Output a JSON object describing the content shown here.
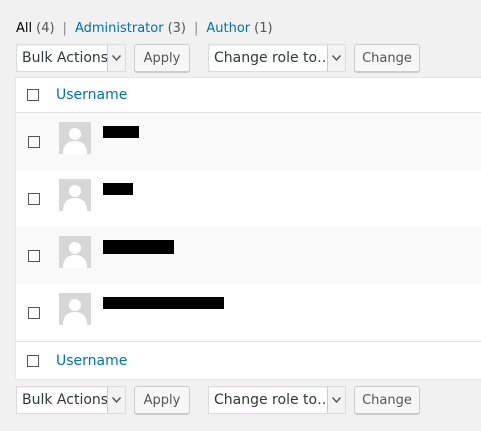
{
  "filters": {
    "all": {
      "label": "All",
      "count": "(4)"
    },
    "administrator": {
      "label": "Administrator",
      "count": "(3)"
    },
    "author": {
      "label": "Author",
      "count": "(1)"
    },
    "separator": "|"
  },
  "tablenav": {
    "bulk_actions": "Bulk Actions",
    "apply": "Apply",
    "change_role": "Change role to…",
    "change": "Change"
  },
  "table": {
    "column_username": "Username"
  },
  "icons": {
    "avatar": "avatar-icon",
    "dropdown": "chevron-down-icon",
    "redaction": "redaction-bar"
  },
  "colors": {
    "link": "#0073aa",
    "background": "#f1f1f1",
    "avatar": "#d7d7d7"
  }
}
